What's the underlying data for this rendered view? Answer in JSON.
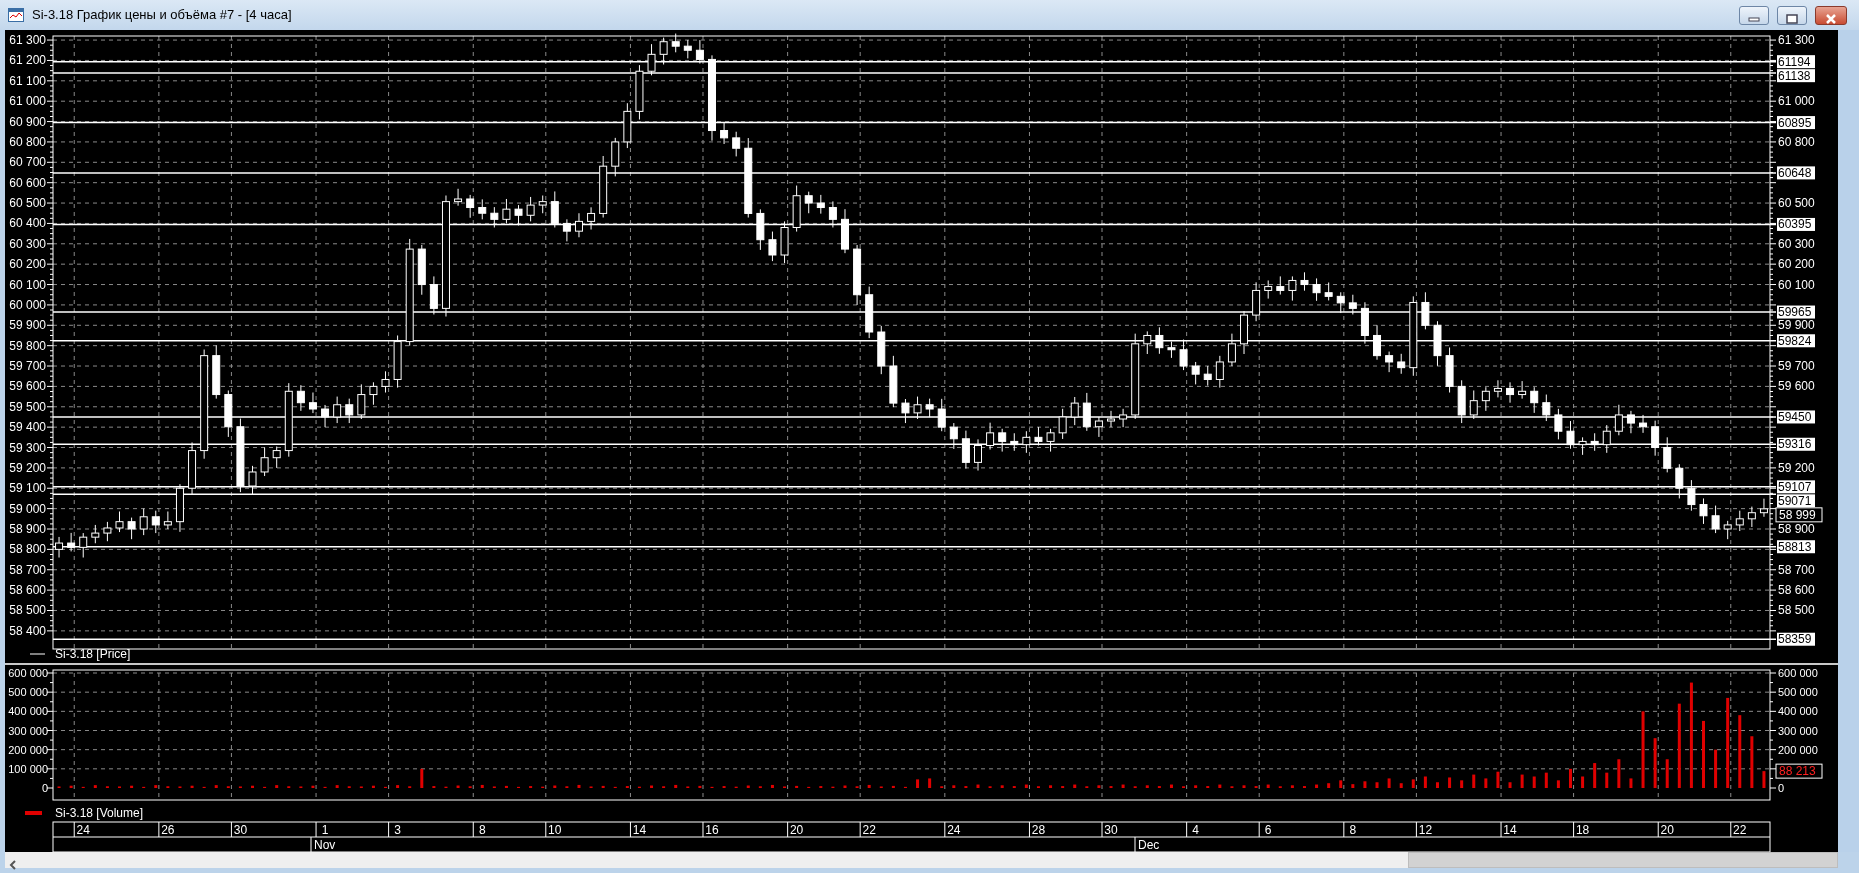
{
  "window": {
    "title": "Si-3.18 График цены и объёма #7 - [4 часа]"
  },
  "price_panel": {
    "right_axis_labels": [
      "61 300",
      "61 000",
      "60 800",
      "60 500",
      "60 300",
      "60 200",
      "60 100",
      "59 900",
      "59 700",
      "59 600",
      "59 200",
      "58 900",
      "58 700",
      "58 600",
      "58 500"
    ],
    "level_labels": [
      "61194",
      "61138",
      "60895",
      "60648",
      "60395",
      "59965",
      "59824",
      "59450",
      "59316",
      "59107",
      "59071",
      "58813",
      "58359"
    ],
    "current_price": "58 999",
    "legend": "Si-3.18 [Price]",
    "chart_data": {
      "type": "candlestick",
      "ylim": [
        58311,
        61320
      ],
      "grid": true,
      "yticks": [
        {
          "value": 61300,
          "label": "61 300"
        },
        {
          "value": 61200,
          "label": "61 200"
        },
        {
          "value": 61100,
          "label": "61 100"
        },
        {
          "value": 61000,
          "label": "61 000"
        },
        {
          "value": 60900,
          "label": "60 900"
        },
        {
          "value": 60800,
          "label": "60 800"
        },
        {
          "value": 60700,
          "label": "60 700"
        },
        {
          "value": 60600,
          "label": "60 600"
        },
        {
          "value": 60500,
          "label": "60 500"
        },
        {
          "value": 60400,
          "label": "60 400"
        },
        {
          "value": 60300,
          "label": "60 300"
        },
        {
          "value": 60200,
          "label": "60 200"
        },
        {
          "value": 60100,
          "label": "60 100"
        },
        {
          "value": 60000,
          "label": "60 000"
        },
        {
          "value": 59900,
          "label": "59 900"
        },
        {
          "value": 59800,
          "label": "59 800"
        },
        {
          "value": 59700,
          "label": "59 700"
        },
        {
          "value": 59600,
          "label": "59 600"
        },
        {
          "value": 59500,
          "label": "59 500"
        },
        {
          "value": 59400,
          "label": "59 400"
        },
        {
          "value": 59300,
          "label": "59 300"
        },
        {
          "value": 59200,
          "label": "59 200"
        },
        {
          "value": 59100,
          "label": "59 100"
        },
        {
          "value": 59000,
          "label": "59 000"
        },
        {
          "value": 58900,
          "label": "58 900"
        },
        {
          "value": 58800,
          "label": "58 800"
        },
        {
          "value": 58700,
          "label": "58 700"
        },
        {
          "value": 58600,
          "label": "58 600"
        },
        {
          "value": 58500,
          "label": "58 500"
        },
        {
          "value": 58400,
          "label": "58 400"
        }
      ],
      "categories": [
        null,
        null,
        null,
        null,
        null,
        null,
        null,
        null,
        null,
        null,
        null,
        null,
        null,
        null,
        null,
        null,
        null,
        null,
        null,
        null,
        null,
        null,
        null,
        null,
        null,
        null,
        null,
        null,
        null,
        null,
        null,
        null,
        null,
        null,
        null,
        null,
        null,
        null,
        null,
        null,
        null,
        null,
        null,
        null,
        null,
        null,
        null,
        null,
        null,
        null,
        null,
        null,
        null,
        null,
        null,
        null,
        null,
        null,
        null,
        null,
        null,
        null,
        null,
        null,
        null,
        null,
        null,
        null,
        null,
        null,
        null,
        null,
        null,
        null,
        null,
        null,
        null,
        null,
        null,
        null,
        null,
        null,
        null,
        null,
        null,
        null,
        null,
        null,
        null,
        null,
        null,
        null,
        null,
        null,
        null,
        null,
        null,
        null,
        null,
        null,
        null,
        null,
        null,
        null,
        null,
        null,
        null,
        null,
        null,
        null,
        null,
        null,
        null,
        null,
        null,
        null,
        null,
        null,
        null,
        null,
        null,
        null,
        null,
        null,
        null,
        null,
        null,
        null,
        null,
        null,
        null,
        null,
        null,
        null,
        null,
        null,
        null,
        null,
        null,
        null,
        null,
        null
      ],
      "ohlc": [
        [
          58800,
          58861,
          58760,
          58831
        ],
        [
          58831,
          58881,
          58790,
          58810
        ],
        [
          58810,
          58880,
          58760,
          58860
        ],
        [
          58860,
          58920,
          58830,
          58880
        ],
        [
          58880,
          58935,
          58840,
          58905
        ],
        [
          58905,
          58986,
          58885,
          58936
        ],
        [
          58936,
          58956,
          58850,
          58900
        ],
        [
          58900,
          59000,
          58870,
          58960
        ],
        [
          58960,
          58990,
          58880,
          58920
        ],
        [
          58920,
          58986,
          58900,
          58936
        ],
        [
          58936,
          59120,
          58886,
          59100
        ],
        [
          59100,
          59325,
          59070,
          59285
        ],
        [
          59285,
          59781,
          59245,
          59751
        ],
        [
          59751,
          59801,
          59540,
          59560
        ],
        [
          59560,
          59580,
          59352,
          59402
        ],
        [
          59402,
          59442,
          59081,
          59111
        ],
        [
          59111,
          59210,
          59071,
          59180
        ],
        [
          59180,
          59300,
          59160,
          59250
        ],
        [
          59250,
          59305,
          59200,
          59285
        ],
        [
          59285,
          59616,
          59255,
          59576
        ],
        [
          59576,
          59606,
          59480,
          59520
        ],
        [
          59520,
          59570,
          59469,
          59489
        ],
        [
          59489,
          59509,
          59400,
          59450
        ],
        [
          59450,
          59550,
          59420,
          59510
        ],
        [
          59510,
          59540,
          59420,
          59460
        ],
        [
          59460,
          59610,
          59440,
          59560
        ],
        [
          59560,
          59620,
          59510,
          59600
        ],
        [
          59600,
          59674,
          59570,
          59634
        ],
        [
          59634,
          59850,
          59594,
          59820
        ],
        [
          59820,
          60324,
          59800,
          60274
        ],
        [
          60274,
          60294,
          60050,
          60100
        ],
        [
          60100,
          60140,
          59953,
          59983
        ],
        [
          59983,
          60537,
          59943,
          60507
        ],
        [
          60507,
          60570,
          60487,
          60520
        ],
        [
          60520,
          60540,
          60428,
          60478
        ],
        [
          60478,
          60518,
          60420,
          60450
        ],
        [
          60450,
          60480,
          60380,
          60420
        ],
        [
          60420,
          60520,
          60400,
          60470
        ],
        [
          60470,
          60490,
          60390,
          60440
        ],
        [
          60440,
          60530,
          60410,
          60490
        ],
        [
          60490,
          60537,
          60450,
          60507
        ],
        [
          60507,
          60557,
          60380,
          60400
        ],
        [
          60400,
          60420,
          60312,
          60362
        ],
        [
          60362,
          60450,
          60332,
          60410
        ],
        [
          60410,
          60479,
          60370,
          60449
        ],
        [
          60449,
          60731,
          60429,
          60681
        ],
        [
          60681,
          60820,
          60631,
          60800
        ],
        [
          60800,
          60990,
          60770,
          60950
        ],
        [
          60950,
          61177,
          60910,
          61147
        ],
        [
          61147,
          61280,
          61127,
          61230
        ],
        [
          61230,
          61312,
          61180,
          61292
        ],
        [
          61292,
          61332,
          61240,
          61270
        ],
        [
          61270,
          61300,
          61210,
          61250
        ],
        [
          61250,
          61300,
          61185,
          61205
        ],
        [
          61205,
          61225,
          60806,
          60856
        ],
        [
          60856,
          60896,
          60790,
          60820
        ],
        [
          60820,
          60850,
          60729,
          60769
        ],
        [
          60769,
          60819,
          60429,
          60449
        ],
        [
          60449,
          60469,
          60270,
          60320
        ],
        [
          60320,
          60360,
          60215,
          60245
        ],
        [
          60245,
          60410,
          60205,
          60380
        ],
        [
          60380,
          60586,
          60360,
          60536
        ],
        [
          60536,
          60556,
          60450,
          60500
        ],
        [
          60500,
          60540,
          60448,
          60478
        ],
        [
          60478,
          60508,
          60380,
          60420
        ],
        [
          60420,
          60470,
          60254,
          60274
        ],
        [
          60274,
          60294,
          60000,
          60050
        ],
        [
          60050,
          60090,
          59837,
          59867
        ],
        [
          59867,
          59897,
          59660,
          59700
        ],
        [
          59700,
          59750,
          59498,
          59518
        ],
        [
          59518,
          59538,
          59420,
          59470
        ],
        [
          59470,
          59550,
          59440,
          59510
        ],
        [
          59510,
          59540,
          59449,
          59489
        ],
        [
          59489,
          59539,
          59380,
          59400
        ],
        [
          59400,
          59420,
          59293,
          59343
        ],
        [
          59343,
          59383,
          59197,
          59227
        ],
        [
          59227,
          59340,
          59187,
          59310
        ],
        [
          59310,
          59422,
          59290,
          59372
        ],
        [
          59372,
          59392,
          59280,
          59330
        ],
        [
          59330,
          59370,
          59284,
          59314
        ],
        [
          59314,
          59380,
          59274,
          59350
        ],
        [
          59350,
          59400,
          59310,
          59330
        ],
        [
          59330,
          59392,
          59280,
          59372
        ],
        [
          59372,
          59490,
          59342,
          59450
        ],
        [
          59450,
          59548,
          59410,
          59518
        ],
        [
          59518,
          59568,
          59382,
          59402
        ],
        [
          59402,
          59450,
          59352,
          59430
        ],
        [
          59430,
          59480,
          59400,
          59440
        ],
        [
          59440,
          59490,
          59400,
          59460
        ],
        [
          59460,
          59859,
          59440,
          59809
        ],
        [
          59809,
          59870,
          59759,
          59850
        ],
        [
          59850,
          59890,
          59760,
          59790
        ],
        [
          59790,
          59820,
          59740,
          59780
        ],
        [
          59780,
          59830,
          59680,
          59700
        ],
        [
          59700,
          59720,
          59610,
          59660
        ],
        [
          59660,
          59700,
          59604,
          59634
        ],
        [
          59634,
          59750,
          59594,
          59720
        ],
        [
          59720,
          59859,
          59700,
          59809
        ],
        [
          59809,
          59970,
          59759,
          59950
        ],
        [
          59950,
          60111,
          59920,
          60071
        ],
        [
          60071,
          60120,
          60031,
          60090
        ],
        [
          60090,
          60140,
          60051,
          60071
        ],
        [
          60071,
          60140,
          60021,
          60120
        ],
        [
          60120,
          60160,
          60070,
          60100
        ],
        [
          60100,
          60130,
          60020,
          60060
        ],
        [
          60060,
          60110,
          60022,
          60042
        ],
        [
          60042,
          60062,
          59960,
          60010
        ],
        [
          60010,
          60050,
          59953,
          59983
        ],
        [
          59983,
          60013,
          59810,
          59850
        ],
        [
          59850,
          59900,
          59731,
          59751
        ],
        [
          59751,
          59771,
          59670,
          59720
        ],
        [
          59720,
          59760,
          59662,
          59692
        ],
        [
          59692,
          60042,
          59652,
          60012
        ],
        [
          60012,
          60062,
          59880,
          59900
        ],
        [
          59900,
          59920,
          59701,
          59751
        ],
        [
          59751,
          59791,
          59570,
          59600
        ],
        [
          59600,
          59630,
          59420,
          59460
        ],
        [
          59460,
          59580,
          59440,
          59530
        ],
        [
          59530,
          59596,
          59480,
          59576
        ],
        [
          59576,
          59630,
          59546,
          59590
        ],
        [
          59590,
          59620,
          59520,
          59560
        ],
        [
          59560,
          59626,
          59540,
          59576
        ],
        [
          59576,
          59596,
          59470,
          59520
        ],
        [
          59520,
          59560,
          59430,
          59460
        ],
        [
          59460,
          59490,
          59340,
          59380
        ],
        [
          59380,
          59430,
          59294,
          59314
        ],
        [
          59314,
          59350,
          59264,
          59330
        ],
        [
          59330,
          59370,
          59284,
          59314
        ],
        [
          59314,
          59410,
          59274,
          59380
        ],
        [
          59380,
          59510,
          59360,
          59460
        ],
        [
          59460,
          59480,
          59370,
          59420
        ],
        [
          59420,
          59460,
          59372,
          59402
        ],
        [
          59402,
          59432,
          59260,
          59300
        ],
        [
          59300,
          59350,
          59178,
          59198
        ],
        [
          59198,
          59218,
          59050,
          59100
        ],
        [
          59100,
          59140,
          58990,
          59020
        ],
        [
          59020,
          59050,
          58925,
          58965
        ],
        [
          58965,
          59015,
          58880,
          58900
        ],
        [
          58900,
          58940,
          58850,
          58920
        ],
        [
          58920,
          58990,
          58890,
          58950
        ],
        [
          58950,
          59010,
          58910,
          58980
        ],
        [
          58980,
          59049,
          58960,
          58999
        ]
      ]
    }
  },
  "volume_panel": {
    "right_axis_labels": [
      "600 000",
      "500 000",
      "400 000",
      "300 000",
      "200 000",
      "0"
    ],
    "current_volume": "88 213",
    "legend": "Si-3.18 [Volume]",
    "chart_data": {
      "type": "bar",
      "ylim": [
        0,
        600000
      ],
      "grid": true,
      "yticks": [
        {
          "value": 600000,
          "label": "600 000"
        },
        {
          "value": 500000,
          "label": "500 000"
        },
        {
          "value": 400000,
          "label": "400 000"
        },
        {
          "value": 300000,
          "label": "300 000"
        },
        {
          "value": 200000,
          "label": "200 000"
        },
        {
          "value": 100000,
          "label": "100 000"
        },
        {
          "value": 0,
          "label": "0"
        }
      ],
      "categories": [
        null,
        null,
        "24",
        null,
        null,
        null,
        null,
        null,
        null,
        "26",
        null,
        null,
        null,
        null,
        null,
        "30",
        null,
        null,
        null,
        null,
        null,
        null,
        "1",
        null,
        null,
        null,
        null,
        null,
        "3",
        null,
        null,
        null,
        null,
        null,
        null,
        "8",
        null,
        null,
        null,
        null,
        null,
        "10",
        null,
        null,
        null,
        null,
        null,
        null,
        "14",
        null,
        null,
        null,
        null,
        null,
        "16",
        null,
        null,
        null,
        null,
        null,
        null,
        "20",
        null,
        null,
        null,
        null,
        null,
        "22",
        null,
        null,
        null,
        null,
        null,
        null,
        "24",
        null,
        null,
        null,
        null,
        null,
        null,
        "28",
        null,
        null,
        null,
        null,
        null,
        "30",
        null,
        null,
        null,
        null,
        null,
        null,
        "4",
        null,
        null,
        null,
        null,
        null,
        "6",
        null,
        null,
        null,
        null,
        null,
        null,
        "8",
        null,
        null,
        null,
        null,
        null,
        "12",
        null,
        null,
        null,
        null,
        null,
        null,
        "14",
        null,
        null,
        null,
        null,
        null,
        "18",
        null,
        null,
        null,
        null,
        null,
        null,
        "20",
        null,
        null,
        null,
        null,
        null,
        "22",
        null,
        null
      ],
      "values": [
        8000,
        12000,
        6000,
        15000,
        9000,
        8000,
        12000,
        6000,
        15000,
        9000,
        8000,
        12000,
        6000,
        15000,
        9000,
        8000,
        12000,
        6000,
        15000,
        9000,
        8000,
        12000,
        6000,
        15000,
        9000,
        8000,
        12000,
        6000,
        15000,
        9000,
        100000,
        10000,
        7000,
        13000,
        9000,
        16000,
        8000,
        11000,
        6000,
        10000,
        7000,
        13000,
        9000,
        16000,
        8000,
        11000,
        6000,
        10000,
        7000,
        13000,
        9000,
        16000,
        8000,
        11000,
        6000,
        10000,
        7000,
        13000,
        9000,
        16000,
        8000,
        11000,
        6000,
        10000,
        7000,
        13000,
        9000,
        16000,
        8000,
        11000,
        6000,
        45000,
        50000,
        9000,
        14000,
        10000,
        18000,
        9000,
        14000,
        10000,
        18000,
        9000,
        14000,
        10000,
        18000,
        9000,
        14000,
        10000,
        18000,
        9000,
        14000,
        10000,
        18000,
        9000,
        14000,
        10000,
        18000,
        9000,
        14000,
        10000,
        18000,
        9000,
        14000,
        10000,
        18000,
        25000,
        40000,
        20000,
        35000,
        30000,
        50000,
        25000,
        45000,
        60000,
        30000,
        55000,
        40000,
        70000,
        50000,
        85000,
        30000,
        70000,
        60000,
        80000,
        40000,
        100000,
        60000,
        130000,
        80000,
        150000,
        50000,
        400000,
        260000,
        150000,
        440000,
        550000,
        350000,
        200000,
        470000,
        380000,
        270000,
        88000
      ]
    }
  },
  "date_axis": {
    "months": [
      "Nov",
      "Dec"
    ]
  }
}
